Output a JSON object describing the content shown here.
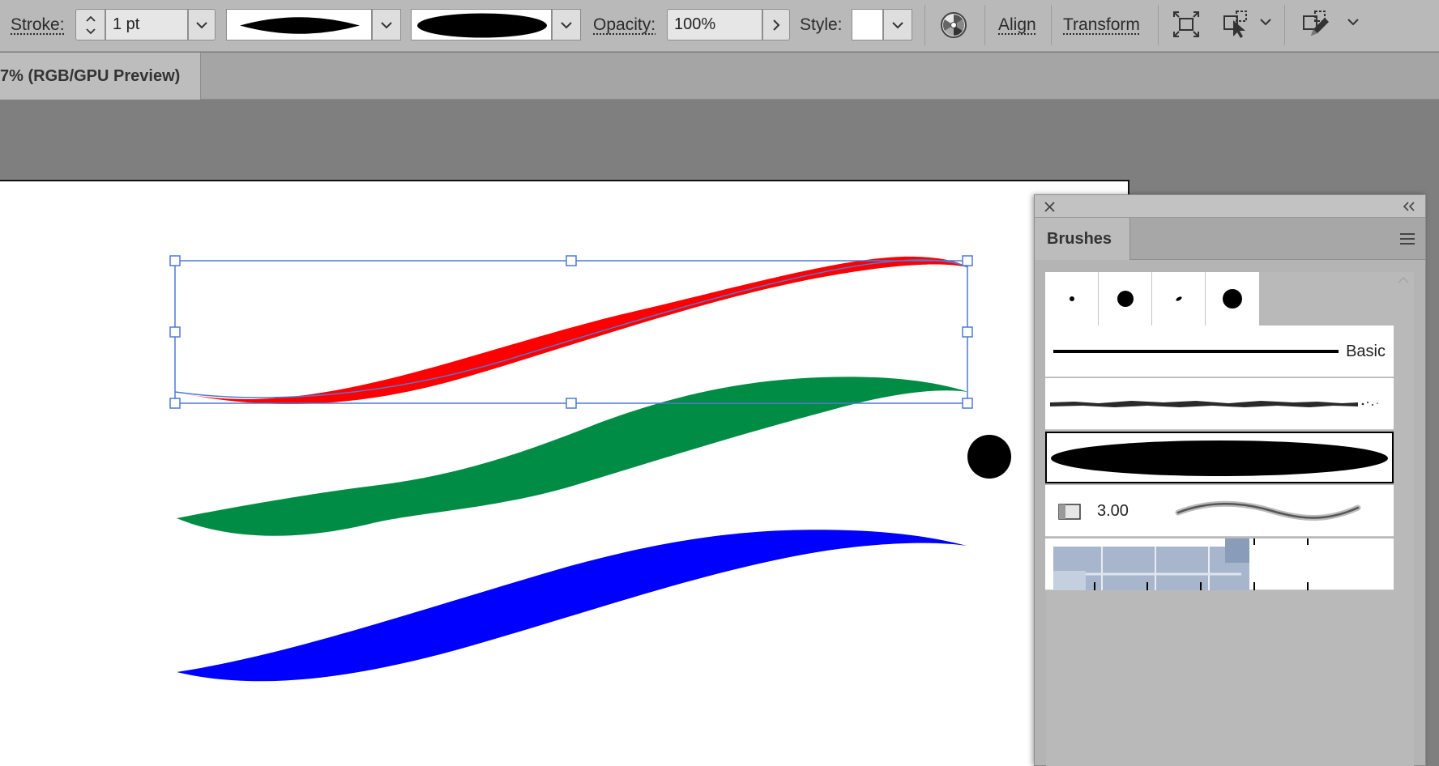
{
  "control_bar": {
    "stroke_label": "Stroke:",
    "stroke_value": "1 pt",
    "opacity_label": "Opacity:",
    "opacity_value": "100%",
    "style_label": "Style:",
    "align_label": "Align",
    "transform_label": "Transform"
  },
  "document": {
    "tab_title": "7% (RGB/GPU Preview)"
  },
  "artwork": {
    "stroke_colors": [
      "#ff0000",
      "#008c45",
      "#0000ff"
    ],
    "selection_color": "#4f78d8",
    "dot_color": "#000000"
  },
  "brushes_panel": {
    "title": "Brushes",
    "rows": [
      {
        "label": "Basic"
      },
      {
        "label": ""
      },
      {
        "label": ""
      },
      {
        "label": "3.00"
      }
    ]
  }
}
